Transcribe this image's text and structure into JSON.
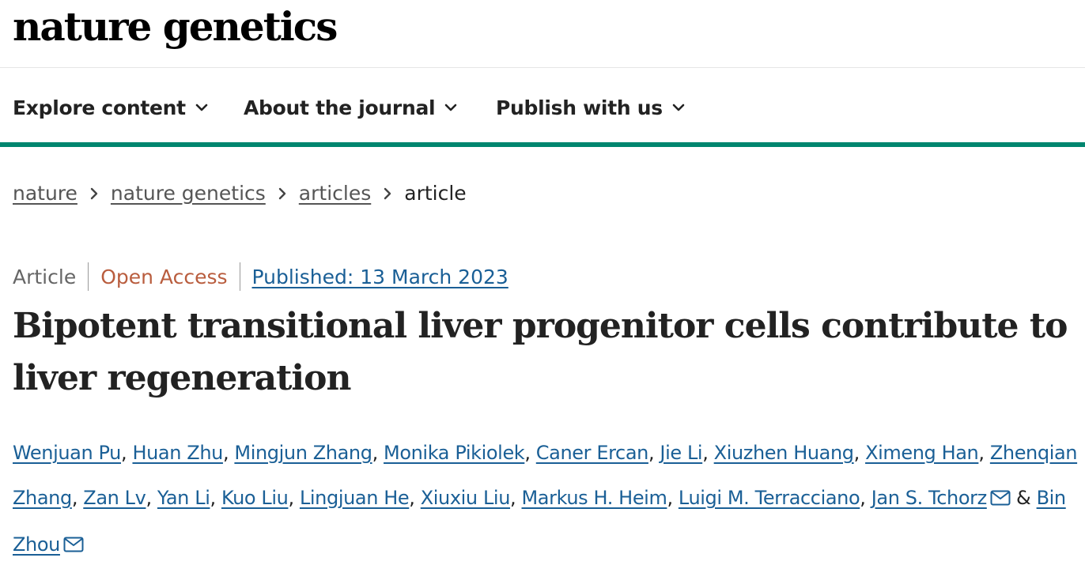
{
  "header": {
    "logo": "nature genetics"
  },
  "nav": {
    "items": [
      {
        "label": "Explore content",
        "icon": "chevron-down-icon"
      },
      {
        "label": "About the journal",
        "icon": "chevron-down-icon"
      },
      {
        "label": "Publish with us",
        "icon": "chevron-down-icon"
      }
    ]
  },
  "breadcrumb": {
    "items": [
      "nature",
      "nature genetics",
      "articles"
    ],
    "current": "article"
  },
  "meta": {
    "type": "Article",
    "access": "Open Access",
    "published": "Published: 13 March 2023"
  },
  "title": "Bipotent transitional liver progenitor cells contribute to liver regeneration",
  "authors": [
    "Wenjuan Pu",
    "Huan Zhu",
    "Mingjun Zhang",
    "Monika Pikiolek",
    "Caner Ercan",
    "Jie Li",
    "Xiuzhen Huang",
    "Ximeng Han",
    "Zhenqian Zhang",
    "Zan Lv",
    "Yan Li",
    "Kuo Liu",
    "Lingjuan He",
    "Xiuxiu Liu",
    "Markus H. Heim",
    "Luigi M. Terracciano",
    "Jan S. Tchorz",
    "Bin Zhou"
  ],
  "authors_connector": "&",
  "colors": {
    "accent_bar": "#00866f",
    "link": "#1a5f96",
    "open_access": "#b95d3e",
    "text": "#222222"
  }
}
